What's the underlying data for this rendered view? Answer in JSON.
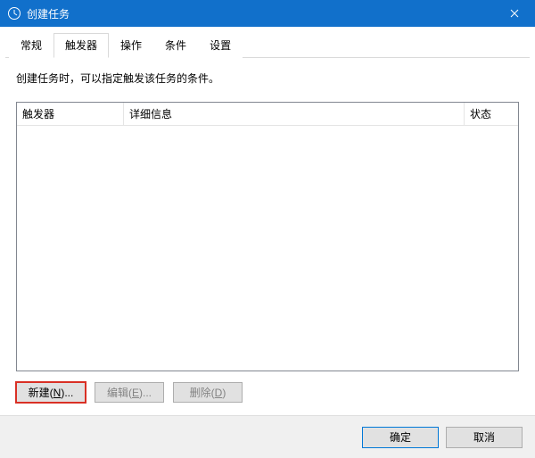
{
  "title": "创建任务",
  "tabs": {
    "general": "常规",
    "triggers": "触发器",
    "actions": "操作",
    "conditions": "条件",
    "settings": "设置"
  },
  "panel": {
    "description": "创建任务时，可以指定触发该任务的条件。",
    "columns": {
      "trigger": "触发器",
      "details": "详细信息",
      "status": "状态"
    },
    "buttons": {
      "new_prefix": "新建(",
      "new_key": "N",
      "new_suffix": ")...",
      "edit_prefix": "编辑(",
      "edit_key": "E",
      "edit_suffix": ")...",
      "delete_prefix": "删除(",
      "delete_key": "D",
      "delete_suffix": ")"
    }
  },
  "footer": {
    "ok": "确定",
    "cancel": "取消"
  }
}
